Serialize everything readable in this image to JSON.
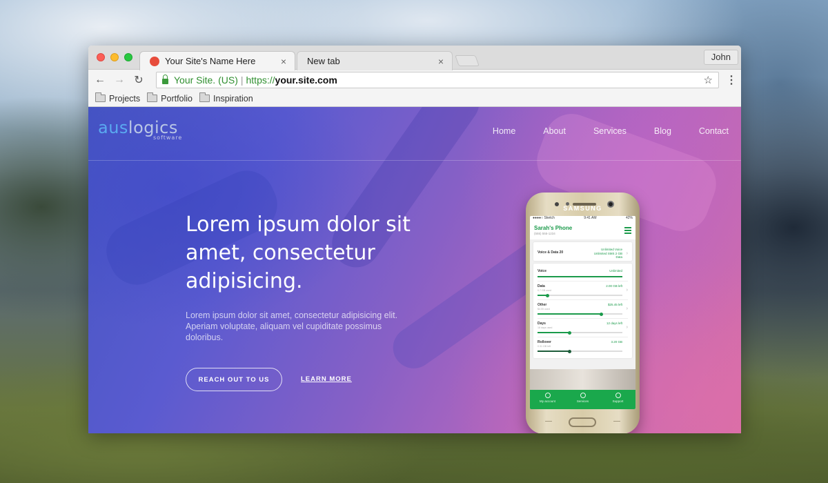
{
  "browser": {
    "tabs": [
      {
        "title": "Your Site's Name Here",
        "close": "×",
        "favicon_color": "#e74c3c"
      },
      {
        "title": "New tab",
        "close": "×"
      }
    ],
    "profile_name": "John",
    "nav": {
      "back": "←",
      "forward": "→",
      "reload": "↻",
      "menu": "⋮"
    },
    "address": {
      "secure_label": "Your Site. (US)",
      "separator": "|",
      "scheme": "https://",
      "host": "your.site.com",
      "star": "☆"
    },
    "bookmarks": [
      "Projects",
      "Portfolio",
      "Inspiration"
    ]
  },
  "site": {
    "logo": {
      "part1": "aus",
      "part2": "logics",
      "sub": "software"
    },
    "nav": [
      "Home",
      "About",
      "Services",
      "Blog",
      "Contact"
    ],
    "headline": "Lorem ipsum dolor sit amet, consectetur adipisicing.",
    "lead": "Lorem ipsum dolor sit amet, consectetur adipisicing elit. Aperiam voluptate, aliquam vel cupiditate possimus doloribus.",
    "cta_primary": "REACH OUT TO US",
    "cta_secondary": "LEARN MORE",
    "colors": {
      "accent_green": "#1a9a4a",
      "logo_blue": "#5aa9f0"
    }
  },
  "phone": {
    "brand": "SAMSUNG",
    "status": {
      "carrier": "●●●●○ Sketch",
      "time": "9:41 AM",
      "battery": "42%"
    },
    "app_title": "Sarah's Phone",
    "app_number": "(555) 555-1234",
    "plan": {
      "label": "Voice & Data 20",
      "detail": "Unlimited Voice Unlimited SMS 2 GB Data"
    },
    "rows": [
      {
        "label": "Voice",
        "value": "Unlimited",
        "sub": "",
        "progress": 1.0
      },
      {
        "label": "Data",
        "value": "2.00 GB left",
        "sub": "0.7 GB used",
        "progress": 0.12
      },
      {
        "label": "Other",
        "value": "$25.45 left",
        "sub": "$4.55 used",
        "progress": 0.75
      },
      {
        "label": "Days",
        "value": "12 days left",
        "sub": "18 days used",
        "progress": 0.38
      },
      {
        "label": "Rollover",
        "value": "3.20 GB",
        "sub": "0.31 GB left",
        "progress": 0.38
      }
    ],
    "tabbar": [
      "My account",
      "Services",
      "Support"
    ]
  }
}
